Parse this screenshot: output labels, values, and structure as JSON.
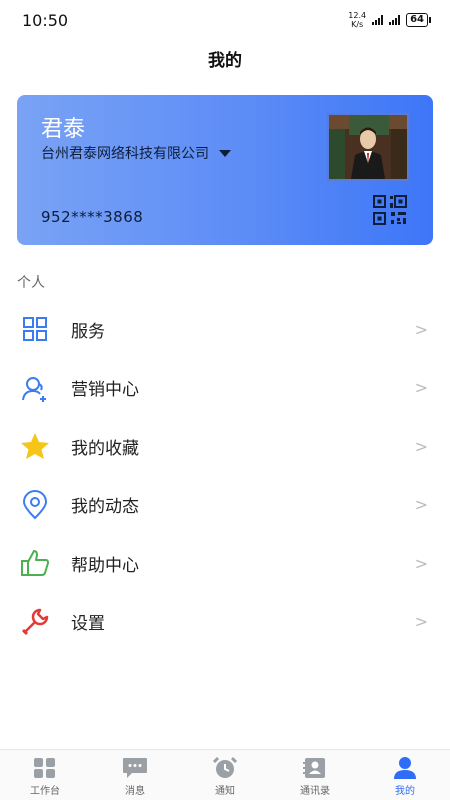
{
  "status_bar": {
    "time": "10:50",
    "net_speed_value": "12.4",
    "net_speed_unit": "K/s",
    "battery": "64"
  },
  "page_title": "我的",
  "card": {
    "user_name": "君泰",
    "company": "台州君泰网络科技有限公司",
    "phone": "952****3868",
    "gradient_start": "#7aa3f5",
    "gradient_end": "#3d76f7"
  },
  "section_label": "个人",
  "menu": [
    {
      "label": "服务",
      "icon": "grid-icon",
      "color": "#3b7df0"
    },
    {
      "label": "营销中心",
      "icon": "user-add-icon",
      "color": "#3b7df0"
    },
    {
      "label": "我的收藏",
      "icon": "star-icon",
      "color": "#f5c518"
    },
    {
      "label": "我的动态",
      "icon": "location-icon",
      "color": "#3b7df0"
    },
    {
      "label": "帮助中心",
      "icon": "thumbs-up-icon",
      "color": "#4caf50"
    },
    {
      "label": "设置",
      "icon": "wrench-icon",
      "color": "#e53935"
    }
  ],
  "chevron": ">",
  "tabbar": [
    {
      "label": "工作台",
      "icon": "workbench-icon",
      "active": false
    },
    {
      "label": "消息",
      "icon": "message-icon",
      "active": false
    },
    {
      "label": "通知",
      "icon": "alarm-clock-icon",
      "active": false
    },
    {
      "label": "通讯录",
      "icon": "contacts-icon",
      "active": false
    },
    {
      "label": "我的",
      "icon": "person-icon",
      "active": true
    }
  ],
  "colors": {
    "accent": "#2f6df6",
    "inactive_tab": "#999999"
  }
}
